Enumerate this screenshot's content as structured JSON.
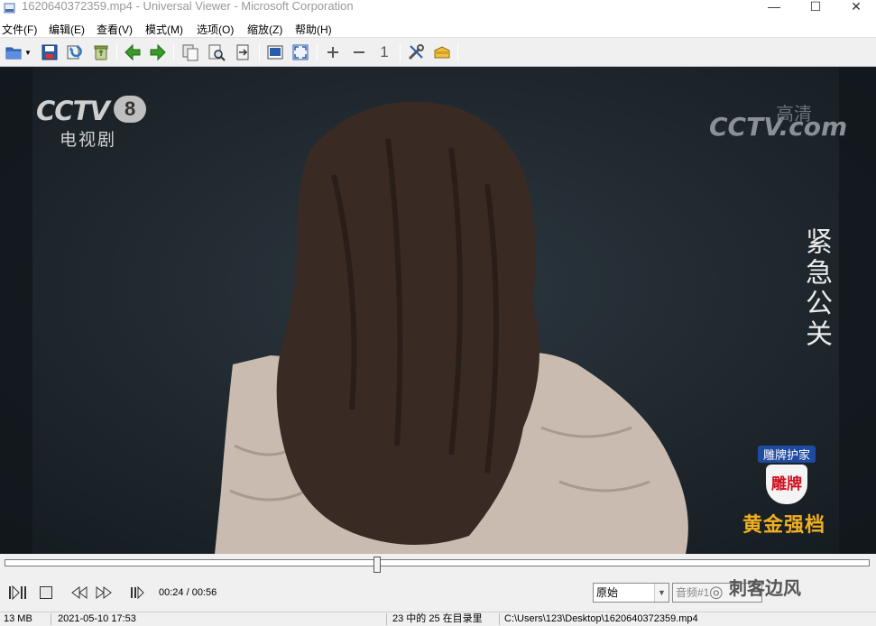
{
  "window": {
    "title": "1620640372359.mp4 - Universal Viewer - Microsoft Corporation",
    "minimize": "—",
    "maximize": "☐",
    "close": "✕"
  },
  "menu": [
    {
      "label": "文件(F)"
    },
    {
      "label": "编辑(E)"
    },
    {
      "label": "查看(V)"
    },
    {
      "label": "模式(M)"
    },
    {
      "label": "选项(O)"
    },
    {
      "label": "缩放(Z)"
    },
    {
      "label": "帮助(H)"
    }
  ],
  "toolbar": {
    "icons": [
      "open-icon",
      "save-icon",
      "reload-icon",
      "recycle-icon",
      "previous-file-icon",
      "next-file-icon",
      "copy-icon",
      "find-icon",
      "print-icon",
      "fit-window-icon",
      "fullscreen-icon",
      "zoom-in-icon",
      "zoom-out-icon",
      "original-size-icon",
      "options-icon",
      "plugins-icon"
    ],
    "zoom_one_label": "1",
    "accent_green": "#3a9a2a"
  },
  "video": {
    "channel_logo": "CCTV",
    "channel_number": "8",
    "channel_name": "电视剧",
    "hd_logo": "CCTV.com",
    "hd_char": "高清",
    "series_title": "紧急公关",
    "sponsor_top": "雕牌护家",
    "sponsor_badge": "雕牌",
    "slot_label": "黄金强档",
    "colors": {
      "background": "#1e262d",
      "logo": "#c8c8c8",
      "slot": "#f0b020"
    }
  },
  "player": {
    "progress_fraction": 0.43,
    "time": "00:24 / 00:56",
    "mode_select": "原始",
    "audio_select": "音频#1",
    "watermark": "刺客边风"
  },
  "status": {
    "size": "13 MB",
    "date": "2021-05-10 17:53",
    "position": "23 中的 25 在目录里",
    "path": "C:\\Users\\123\\Desktop\\1620640372359.mp4"
  }
}
